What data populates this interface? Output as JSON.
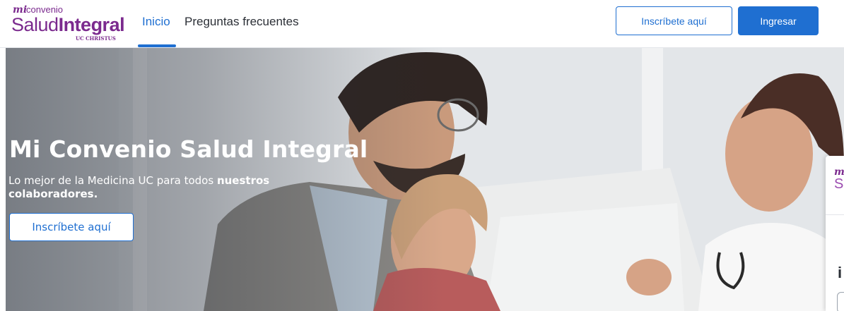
{
  "brand": {
    "mi": "mi",
    "convenio": "convenio",
    "salud": "Salud",
    "integral": "Integral",
    "uc": "UC CHRISTUS",
    "color": "#7b2a8e"
  },
  "nav": {
    "items": [
      {
        "label": "Inicio",
        "active": true
      },
      {
        "label": "Preguntas frecuentes",
        "active": false
      }
    ]
  },
  "header": {
    "enroll_label": "Inscríbete aquí",
    "login_label": "Ingresar"
  },
  "hero": {
    "title": "Mi Convenio Salud Integral",
    "subtitle_regular": "Lo mejor de la Medicina UC para todos ",
    "subtitle_bold": "nuestros colaboradores.",
    "cta_label": "Inscríbete aquí"
  },
  "side_card": {
    "logo_mi": "m",
    "logo_letter": "S",
    "heading_letter": "i"
  },
  "colors": {
    "accent": "#1f6fd1",
    "text": "#2b2f36",
    "brand": "#7b2a8e"
  }
}
